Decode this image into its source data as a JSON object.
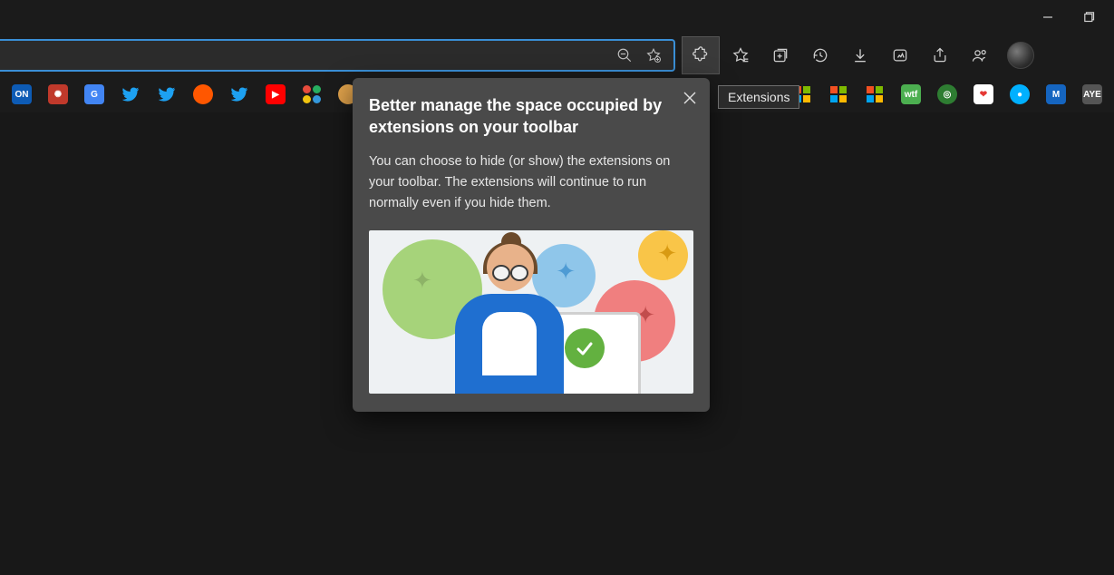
{
  "tooltip": {
    "extensions": "Extensions"
  },
  "popup": {
    "title": "Better manage the space occupied by extensions on your toolbar",
    "body": "You can choose to hide (or show) the extensions on your toolbar. The extensions will continue to run normally even if you hide them."
  },
  "toolbar": {},
  "bookmarks_left": [
    {
      "name": "on",
      "label": "ON",
      "bg": "#0d5bb5"
    },
    {
      "name": "atom",
      "label": "✺",
      "bg": "#c0392b"
    },
    {
      "name": "translate",
      "label": "G",
      "bg": "#4285f4"
    },
    {
      "name": "twitter1",
      "label": "",
      "bg": "transparent",
      "glyph": "twitter"
    },
    {
      "name": "twitter2",
      "label": "",
      "bg": "transparent",
      "glyph": "twitter"
    },
    {
      "name": "reddit",
      "label": "",
      "bg": "#ff5700",
      "round": true
    },
    {
      "name": "twitter3",
      "label": "",
      "bg": "transparent",
      "glyph": "twitter"
    },
    {
      "name": "youtube",
      "label": "▶",
      "bg": "#ff0000"
    },
    {
      "name": "cluster",
      "label": "✦",
      "bg": "transparent",
      "multicolor": true
    },
    {
      "name": "cookie",
      "label": "",
      "bg": "#e0a24b",
      "round": true
    }
  ],
  "bookmarks_right": [
    {
      "name": "ms1",
      "glyph": "ms"
    },
    {
      "name": "ms2",
      "glyph": "ms"
    },
    {
      "name": "ms3",
      "glyph": "ms"
    },
    {
      "name": "wtf",
      "label": "wtf",
      "bg": "#4caf50"
    },
    {
      "name": "eco",
      "label": "◎",
      "bg": "#2e7d32",
      "round": true
    },
    {
      "name": "heart",
      "label": "❤",
      "bg": "#ffffff",
      "fg": "#e53935"
    },
    {
      "name": "cam",
      "label": "●",
      "bg": "#00b0ff",
      "round": true
    },
    {
      "name": "m",
      "label": "M",
      "bg": "#1565c0"
    },
    {
      "name": "aye",
      "label": "AYE",
      "bg": "#555555"
    }
  ]
}
